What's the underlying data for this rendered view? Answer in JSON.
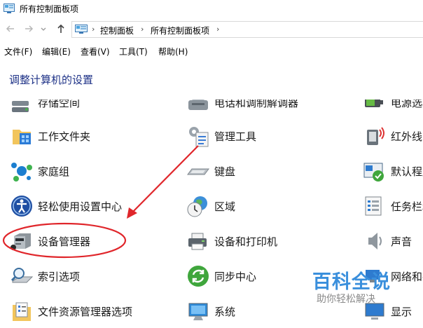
{
  "window": {
    "title": "所有控制面板项"
  },
  "address": {
    "crumbs": [
      "控制面板",
      "所有控制面板项"
    ]
  },
  "menu": [
    "文件(F)",
    "编辑(E)",
    "查看(V)",
    "工具(T)",
    "帮助(H)"
  ],
  "heading": "调整计算机的设置",
  "items": [
    {
      "label": "存储空间",
      "icon": "storage-icon"
    },
    {
      "label": "电话和调制解调器",
      "icon": "phone-modem-icon"
    },
    {
      "label": "电源选项",
      "icon": "power-icon"
    },
    {
      "label": "工作文件夹",
      "icon": "work-folders-icon"
    },
    {
      "label": "管理工具",
      "icon": "admin-tools-icon"
    },
    {
      "label": "红外线",
      "icon": "infrared-icon"
    },
    {
      "label": "家庭组",
      "icon": "homegroup-icon"
    },
    {
      "label": "键盘",
      "icon": "keyboard-icon"
    },
    {
      "label": "默认程序",
      "icon": "default-programs-icon"
    },
    {
      "label": "轻松使用设置中心",
      "icon": "ease-of-access-icon"
    },
    {
      "label": "区域",
      "icon": "region-icon"
    },
    {
      "label": "任务栏和导航",
      "icon": "taskbar-icon"
    },
    {
      "label": "设备管理器",
      "icon": "device-manager-icon"
    },
    {
      "label": "设备和打印机",
      "icon": "devices-printers-icon"
    },
    {
      "label": "声音",
      "icon": "sound-icon"
    },
    {
      "label": "索引选项",
      "icon": "indexing-icon"
    },
    {
      "label": "同步中心",
      "icon": "sync-center-icon"
    },
    {
      "label": "网络和共享中心",
      "icon": "network-icon"
    },
    {
      "label": "文件资源管理器选项",
      "icon": "file-explorer-options-icon"
    },
    {
      "label": "系统",
      "icon": "system-icon"
    },
    {
      "label": "显示",
      "icon": "display-icon"
    }
  ],
  "watermark": {
    "title": "百科全说",
    "subtitle": "助你轻松解决"
  },
  "colors": {
    "heading": "#1e3287",
    "annotation": "#e0262b",
    "watermark": "#3a8fdc"
  }
}
